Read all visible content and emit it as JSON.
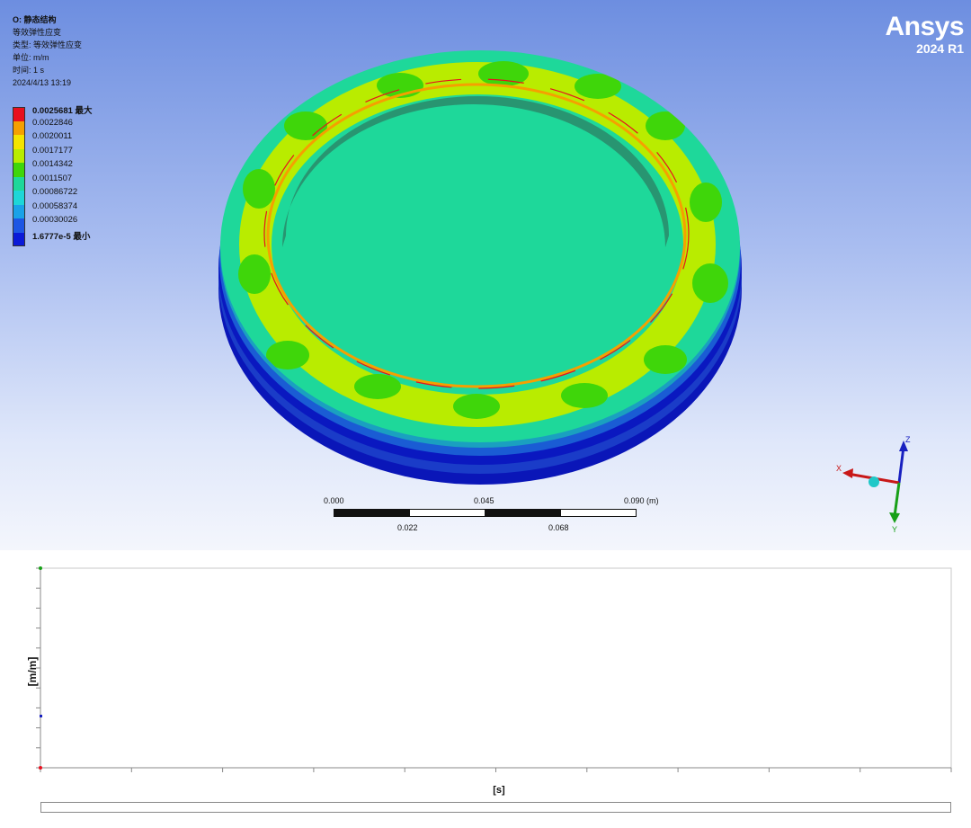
{
  "result": {
    "title": "O: 静态结构",
    "type": "等效弹性应变",
    "type_label": "类型: 等效弹性应变",
    "unit_label": "单位: m/m",
    "time_label": "时间: 1 s",
    "timestamp": "2024/4/13 13:19"
  },
  "legend": {
    "entries": [
      {
        "label": "0.0025681 最大",
        "color": "#e8101e",
        "bold": true
      },
      {
        "label": "0.0022846",
        "color": "#f5a000"
      },
      {
        "label": "0.0020011",
        "color": "#f4e400"
      },
      {
        "label": "0.0017177",
        "color": "#b9ec00"
      },
      {
        "label": "0.0014342",
        "color": "#3fd60a"
      },
      {
        "label": "0.0011507",
        "color": "#1ed89a"
      },
      {
        "label": "0.00086722",
        "color": "#1ed6d8"
      },
      {
        "label": "0.00058374",
        "color": "#1aa2e8"
      },
      {
        "label": "0.00030026",
        "color": "#1d56e4"
      },
      {
        "label": "1.6777e-5 最小",
        "color": "#0a1ad8",
        "bold": true
      }
    ]
  },
  "branding": {
    "name": "Ansys",
    "version": "2024 R1"
  },
  "scale_bar": {
    "top_labels": [
      "0.000",
      "0.045",
      "0.090 (m)"
    ],
    "bottom_labels": [
      "0.022",
      "0.068"
    ]
  },
  "triad": {
    "x": "X",
    "y": "Y",
    "z": "Z",
    "x_color": "#c81818",
    "y_color": "#18a018",
    "z_color": "#1820c0"
  },
  "chart": {
    "ylabel": "[m/m]",
    "xlabel": "[s]"
  }
}
